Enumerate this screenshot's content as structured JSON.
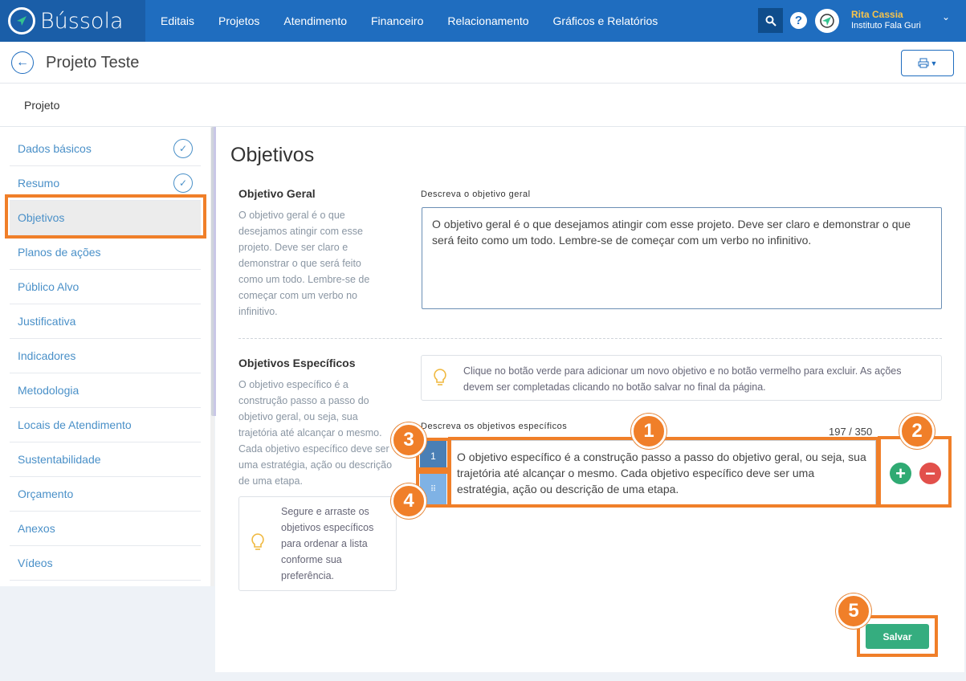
{
  "brand": {
    "name": "Bússola"
  },
  "nav": [
    "Editais",
    "Projetos",
    "Atendimento",
    "Financeiro",
    "Relacionamento",
    "Gráficos e Relatórios"
  ],
  "user": {
    "name": "Rita Cassia",
    "org": "Instituto Fala Guri"
  },
  "header": {
    "title": "Projeto Teste",
    "subtitle": "Projeto"
  },
  "sidebar": {
    "items": [
      {
        "label": "Dados básicos",
        "done": true
      },
      {
        "label": "Resumo",
        "done": true
      },
      {
        "label": "Objetivos",
        "active": true
      },
      {
        "label": "Planos de ações"
      },
      {
        "label": "Público Alvo"
      },
      {
        "label": "Justificativa"
      },
      {
        "label": "Indicadores"
      },
      {
        "label": "Metodologia"
      },
      {
        "label": "Locais de Atendimento"
      },
      {
        "label": "Sustentabilidade"
      },
      {
        "label": "Orçamento"
      },
      {
        "label": "Anexos"
      },
      {
        "label": "Vídeos"
      }
    ]
  },
  "main": {
    "title": "Objetivos",
    "geral": {
      "title": "Objetivo Geral",
      "desc": "O objetivo geral é o que desejamos atingir com esse projeto. Deve ser claro e demonstrar o que será feito como um todo. Lembre-se de começar com um verbo no infinitivo.",
      "label": "Descreva o objetivo geral",
      "value": "O objetivo geral é o que desejamos atingir com esse projeto. Deve ser claro e demonstrar o que será feito como um todo. Lembre-se de começar com um verbo no infinitivo."
    },
    "especificos": {
      "title": "Objetivos Específicos",
      "desc": "O objetivo específico é a construção passo a passo do objetivo geral, ou seja, sua trajetória até alcançar o mesmo. Cada objetivo específico deve ser uma estratégia, ação ou descrição de uma etapa.",
      "tip": "Clique no botão verde para adicionar um novo objetivo e no botão vermelho para excluir. As ações devem ser completadas clicando no botão salvar no final da página.",
      "drag_tip": "Segure e arraste os objetivos específicos para ordenar a lista conforme sua preferência.",
      "label": "Descreva os objetivos específicos",
      "counter": "197 / 350",
      "item_number": "1",
      "value": "O objetivo específico é a construção passo a passo do objetivo geral, ou seja, sua trajetória até alcançar o mesmo. Cada objetivo específico deve ser uma estratégia, ação ou descrição de uma etapa."
    },
    "save_label": "Salvar"
  },
  "annotations": [
    "1",
    "2",
    "3",
    "4",
    "5"
  ],
  "colors": {
    "nav": "#1f6dbf",
    "accent": "#f07f29",
    "green": "#35ad7f",
    "red": "#e2504b"
  }
}
